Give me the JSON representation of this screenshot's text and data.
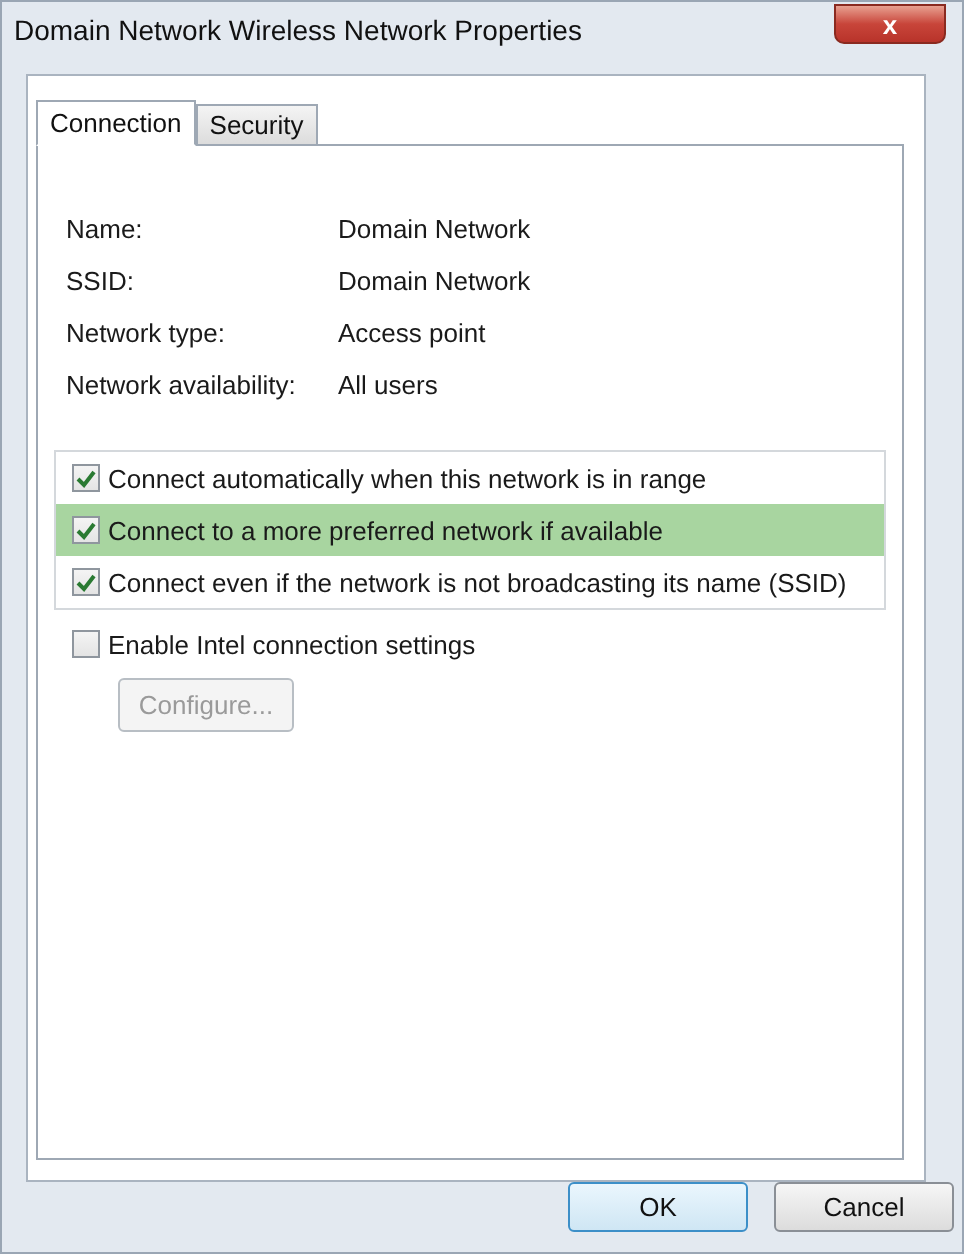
{
  "window": {
    "title": "Domain Network Wireless Network Properties",
    "close": "x"
  },
  "tabs": [
    {
      "label": "Connection",
      "selected": true
    },
    {
      "label": "Security",
      "selected": false
    }
  ],
  "info": [
    {
      "label": "Name:",
      "value": "Domain Network"
    },
    {
      "label": "SSID:",
      "value": "Domain Network"
    },
    {
      "label": "Network type:",
      "value": "Access point"
    },
    {
      "label": "Network availability:",
      "value": "All users"
    }
  ],
  "options": [
    {
      "label": "Connect automatically when this network is in range",
      "checked": true,
      "selected": false
    },
    {
      "label": "Connect to a more preferred network if available",
      "checked": true,
      "selected": true
    },
    {
      "label": "Connect even if the network is not broadcasting its name (SSID)",
      "checked": true,
      "selected": false
    }
  ],
  "intel": {
    "label": "Enable Intel connection settings",
    "checked": false
  },
  "configure": {
    "label": "Configure...",
    "disabled": true
  },
  "buttons": [
    {
      "label": "OK",
      "default": true
    },
    {
      "label": "Cancel",
      "default": false
    }
  ]
}
